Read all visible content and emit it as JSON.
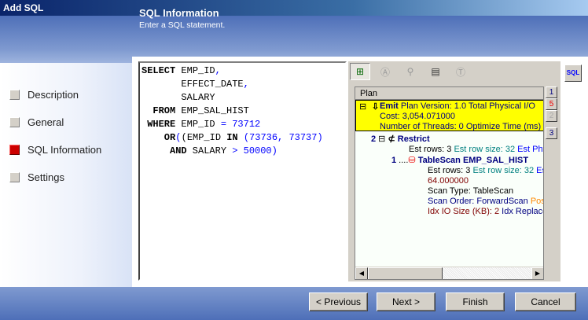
{
  "window": {
    "title": "Add SQL"
  },
  "header": {
    "title": "SQL Information",
    "subtitle": "Enter a SQL statement."
  },
  "nav": [
    {
      "label": "Description",
      "active": false
    },
    {
      "label": "General",
      "active": false
    },
    {
      "label": "SQL Information",
      "active": true
    },
    {
      "label": "Settings",
      "active": false
    }
  ],
  "sql": {
    "l1k": "SELECT",
    "l1": " EMP_ID",
    "c": ",",
    "l2": "       EFFECT_DATE",
    "l3": "       SALARY",
    "l4k": "  FROM",
    "l4": " EMP_SAL_HIST",
    "l5k": " WHERE",
    "l5": " EMP_ID ",
    "l5v": "= 73712",
    "l6k": "    OR",
    "l6a": " (EMP_ID ",
    "l6in": "IN",
    "l6v": " (73736, 73737)",
    "l7k": "     AND",
    "l7": " SALARY ",
    "l7v": "> 50000)"
  },
  "plan": {
    "header": "Plan",
    "emit": {
      "name": "Emit",
      "l1": "Plan Version: 1.0  Total Physical I/O",
      "l2": "Cost: 3,054.071000",
      "l3": "Number of Threads: 0  Optimize Time (ms)"
    },
    "restrict": {
      "num": "2",
      "name": "Restrict",
      "rows": "Est rows: 3",
      "rowsize": "Est row size: 32",
      "phys": "Est Phys"
    },
    "scan": {
      "num": "1",
      "name": "TableScan EMP_SAL_HIST",
      "rows": "Est rows: 3",
      "rowsize": "Est row size: 32",
      "phys": "Est",
      "cost": "64.000000",
      "type": "Scan Type: TableScan",
      "order": "Scan Order: ForwardScan",
      "pos": "Pos",
      "io": "Idx IO Size (KB): 2",
      "repl": "Idx Replace"
    },
    "side_buttons": [
      "1",
      "5",
      "2",
      "3"
    ]
  },
  "sql_button": "SQL",
  "buttons": {
    "previous": "< Previous",
    "next": "Next >",
    "finish": "Finish",
    "cancel": "Cancel"
  }
}
